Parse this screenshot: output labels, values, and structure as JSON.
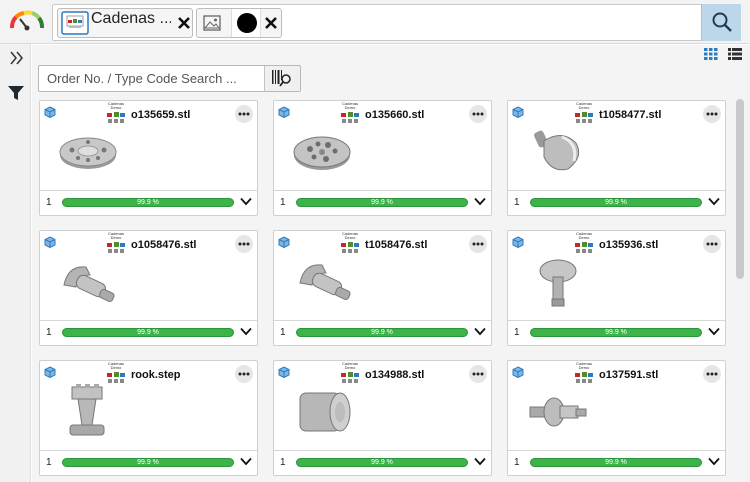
{
  "header": {
    "chip1_label": "Cadenas ...",
    "search_icon": "magnifier-icon",
    "gauge_icon": "speedometer-icon"
  },
  "filters": {
    "order_search_placeholder": "Order No. / Type Code Search ..."
  },
  "cards": [
    {
      "name": "o135659.stl",
      "qty": "1",
      "progress": "99.9 %",
      "progress_fraction": 0.999
    },
    {
      "name": "o135660.stl",
      "qty": "1",
      "progress": "99.9 %",
      "progress_fraction": 0.999
    },
    {
      "name": "t1058477.stl",
      "qty": "1",
      "progress": "99.9 %",
      "progress_fraction": 0.999
    },
    {
      "name": "o1058476.stl",
      "qty": "1",
      "progress": "99.9 %",
      "progress_fraction": 0.999
    },
    {
      "name": "t1058476.stl",
      "qty": "1",
      "progress": "99.9 %",
      "progress_fraction": 0.999
    },
    {
      "name": "o135936.stl",
      "qty": "1",
      "progress": "99.9 %",
      "progress_fraction": 0.999
    },
    {
      "name": "rook.step",
      "qty": "1",
      "progress": "99.9 %",
      "progress_fraction": 0.999
    },
    {
      "name": "o134988.stl",
      "qty": "1",
      "progress": "99.9 %",
      "progress_fraction": 0.999
    },
    {
      "name": "o137591.stl",
      "qty": "1",
      "progress": "99.9 %",
      "progress_fraction": 0.999
    }
  ],
  "logo_text": "Cadenas Demo",
  "colors": {
    "progress_green": "#3cb44a",
    "search_button_bg": "#bcd6ea",
    "icon_blue": "#2b7bbf"
  }
}
